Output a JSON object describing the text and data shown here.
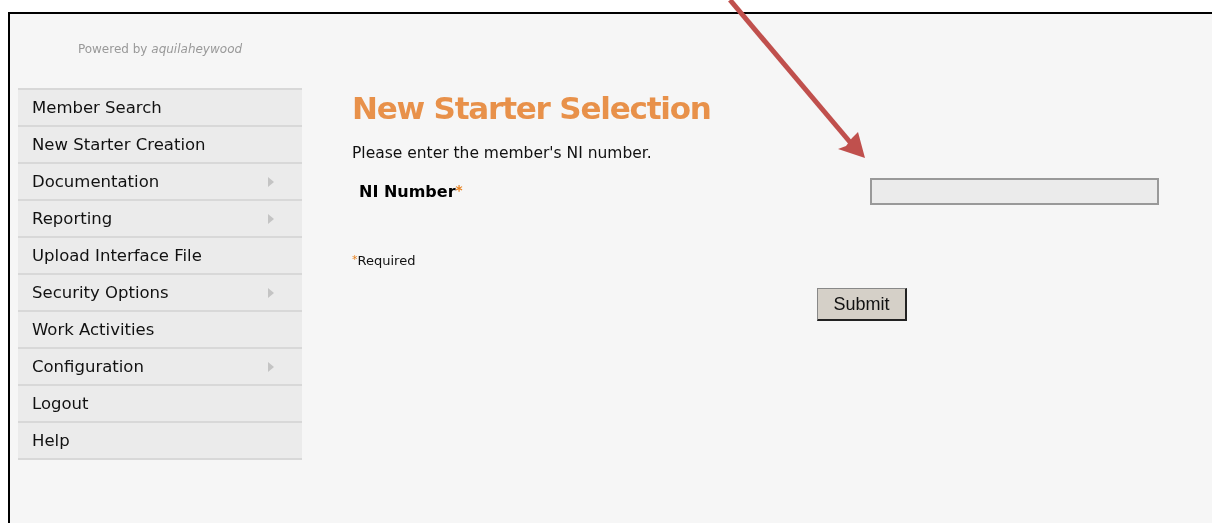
{
  "powered_by": "Powered by *aquilaheywood*",
  "sidebar": {
    "items": [
      {
        "label": "Member Search",
        "has_submenu": false
      },
      {
        "label": "New Starter Creation",
        "has_submenu": false
      },
      {
        "label": "Documentation",
        "has_submenu": true
      },
      {
        "label": "Reporting",
        "has_submenu": true
      },
      {
        "label": "Upload Interface File",
        "has_submenu": false
      },
      {
        "label": "Security Options",
        "has_submenu": true
      },
      {
        "label": "Work Activities",
        "has_submenu": false
      },
      {
        "label": "Configuration",
        "has_submenu": true
      },
      {
        "label": "Logout",
        "has_submenu": false
      },
      {
        "label": "Help",
        "has_submenu": false
      }
    ]
  },
  "page": {
    "title": "New Starter Selection",
    "instruction": "Please enter the member's NI number.",
    "fields": [
      {
        "label": "NI Number",
        "required": true,
        "required_mark": "*"
      }
    ],
    "required_note": {
      "mark": "*",
      "text": "Required"
    },
    "submit_button": "Submit"
  }
}
